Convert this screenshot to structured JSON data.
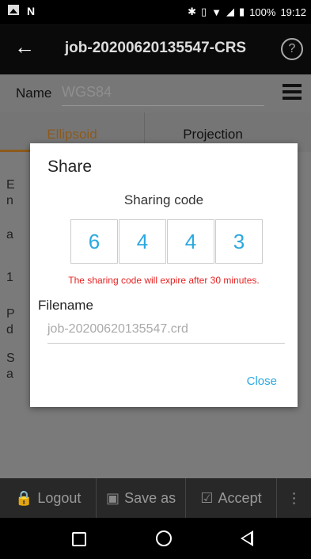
{
  "status_bar": {
    "battery": "100%",
    "time": "19:12"
  },
  "app_bar": {
    "title": "job-20200620135547-CRS",
    "help": "?"
  },
  "name_row": {
    "label": "Name",
    "value": "WGS84"
  },
  "tabs": [
    {
      "label": "Ellipsoid"
    },
    {
      "label": "Projection"
    }
  ],
  "background_fragments": [
    "E",
    "n",
    "a",
    "1",
    "P",
    "d",
    "S",
    "a"
  ],
  "dialog": {
    "title": "Share",
    "subtitle": "Sharing code",
    "code": [
      "6",
      "4",
      "4",
      "3"
    ],
    "expire_note": "The sharing code will expire after 30 minutes.",
    "filename_label": "Filename",
    "filename_value": "job-20200620135547.crd",
    "close_label": "Close"
  },
  "bottom_bar": {
    "logout": "Logout",
    "save_as": "Save as",
    "accept": "Accept"
  },
  "colors": {
    "accent": "#2aa8e0",
    "warning": "#e82222",
    "tab_active": "#8c5a1c"
  }
}
